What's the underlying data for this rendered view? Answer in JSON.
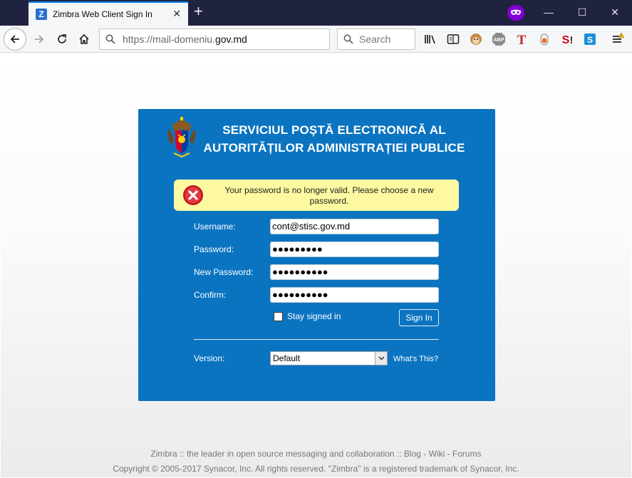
{
  "browser": {
    "tab_title": "Zimbra Web Client Sign In",
    "tab_favicon_letter": "Z",
    "url_prefix": "https://mail-domeniu.",
    "url_domain": "gov.md",
    "search_placeholder": "Search",
    "toolbar_icons": [
      "library-icon",
      "reader-view-icon",
      "monkey-icon",
      "adblock-icon",
      "text-t-icon",
      "rss-icon",
      "s-exclaim-icon",
      "s-box-icon",
      "menu-icon"
    ],
    "accent_color": "#0a84ff"
  },
  "login": {
    "header_line1": "SERVICIUL POȘTĂ ELECTRONICĂ AL",
    "header_line2": "AUTORITĂȚILOR ADMINISTRAȚIEI PUBLICE",
    "box_color": "#0b74c1",
    "error_message": "Your password is no longer valid. Please choose a new password.",
    "error_bg": "#fdf9a0",
    "fields": {
      "username_label": "Username:",
      "username_value": "cont@stisc.gov.md",
      "password_label": "Password:",
      "password_value": "●●●●●●●●●",
      "new_password_label": "New Password:",
      "new_password_value": "●●●●●●●●●●",
      "confirm_label": "Confirm:",
      "confirm_value": "●●●●●●●●●●"
    },
    "stay_signed_in_label": "Stay signed in",
    "stay_signed_in_checked": false,
    "sign_in_label": "Sign In",
    "version_label": "Version:",
    "version_selected": "Default",
    "whats_this_label": "What's This?"
  },
  "footer": {
    "line1": "Zimbra :: the leader in open source messaging and collaboration :: Blog - Wiki - Forums",
    "line2": "Copyright © 2005-2017 Synacor, Inc. All rights reserved. \"Zimbra\" is a registered trademark of Synacor, Inc."
  }
}
